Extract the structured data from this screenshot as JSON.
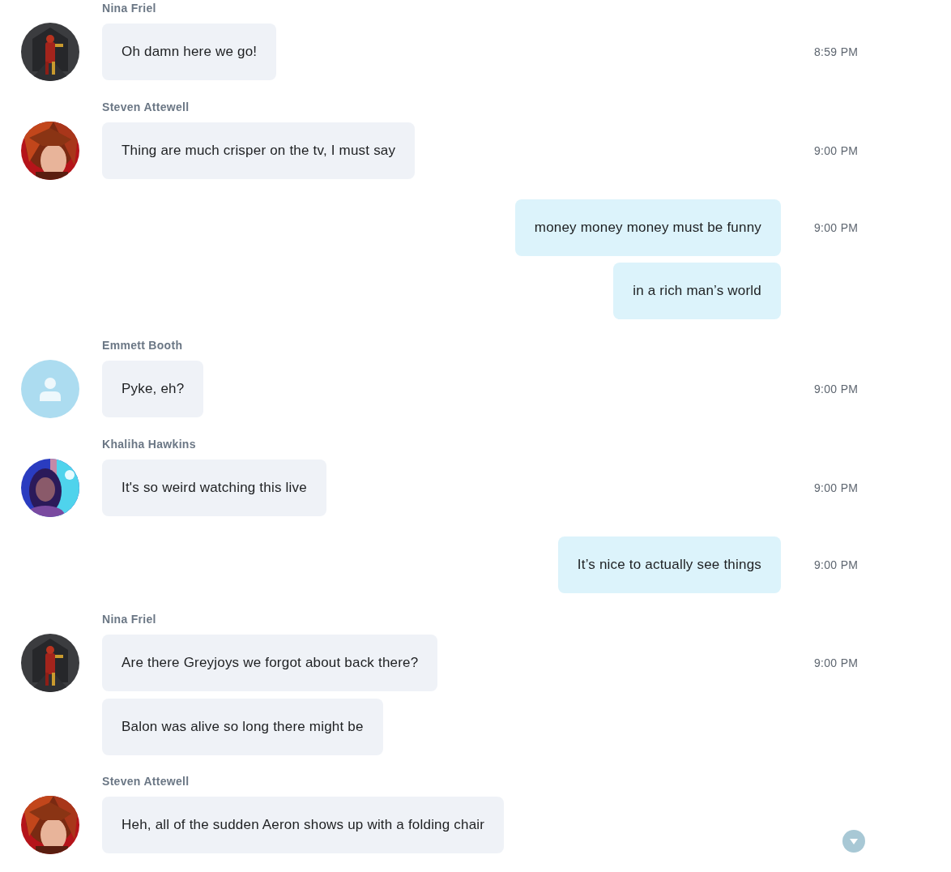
{
  "groups": [
    {
      "outgoing": false,
      "author": "Nina Friel",
      "avatar": {
        "kind": "picture"
      },
      "messages": [
        {
          "text": "Oh damn here we go!",
          "time": "8:59 PM"
        }
      ]
    },
    {
      "outgoing": false,
      "author": "Steven Attewell",
      "avatar": {
        "kind": "picture"
      },
      "messages": [
        {
          "text": "Thing are much crisper on the tv, I must say",
          "time": "9:00 PM"
        }
      ]
    },
    {
      "outgoing": true,
      "messages": [
        {
          "text": "money money money must be funny",
          "time": "9:00 PM"
        },
        {
          "text": "in a rich man’s world"
        }
      ]
    },
    {
      "outgoing": false,
      "author": "Emmett Booth",
      "avatar": {
        "kind": "placeholder"
      },
      "messages": [
        {
          "text": "Pyke, eh?",
          "time": "9:00 PM"
        }
      ]
    },
    {
      "outgoing": false,
      "author": "Khaliha Hawkins",
      "avatar": {
        "kind": "picture"
      },
      "messages": [
        {
          "text": "It's so weird watching this live",
          "time": "9:00 PM"
        }
      ]
    },
    {
      "outgoing": true,
      "messages": [
        {
          "text": "It’s nice to actually  see things",
          "time": "9:00 PM"
        }
      ]
    },
    {
      "outgoing": false,
      "author": "Nina Friel",
      "avatar": {
        "kind": "picture"
      },
      "messages": [
        {
          "text": "Are there Greyjoys we forgot about back there?",
          "time": "9:00 PM"
        },
        {
          "text": "Balon was alive so long there might be"
        }
      ]
    },
    {
      "outgoing": false,
      "author": "Steven Attewell",
      "avatar": {
        "kind": "picture"
      },
      "messages": [
        {
          "text": "Heh, all of the sudden Aeron shows up with a folding chair"
        }
      ]
    }
  ],
  "scroll_down_button": {
    "visible": true
  }
}
